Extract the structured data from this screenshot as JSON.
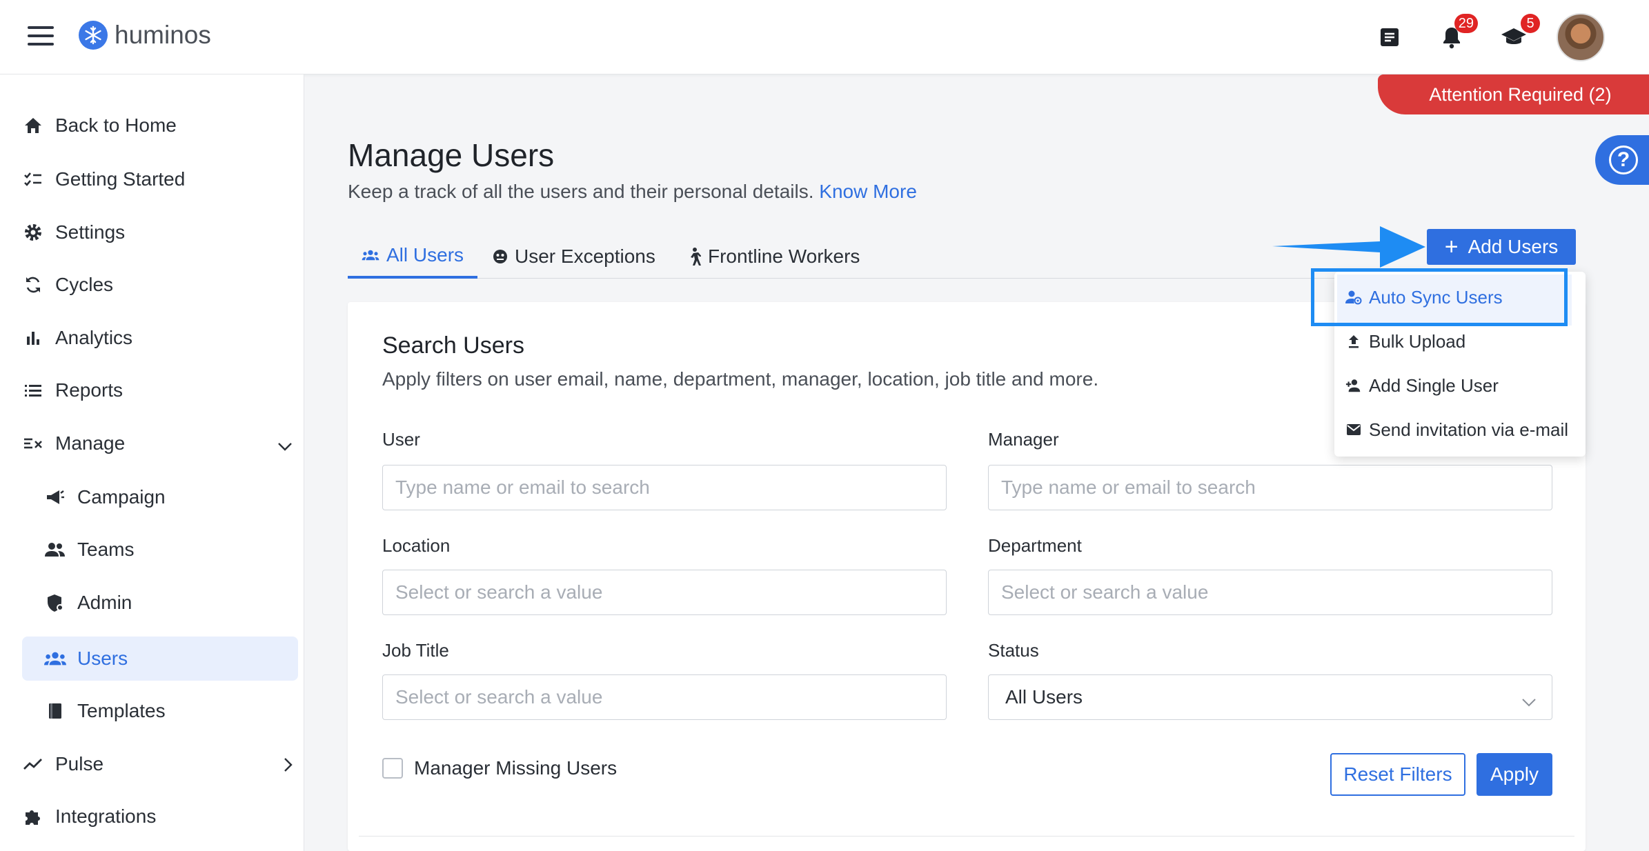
{
  "app": {
    "name": "huminos"
  },
  "header": {
    "notifications_count": "29",
    "courses_count": "5",
    "attention_label": "Attention Required (2)"
  },
  "sidebar": {
    "items": [
      {
        "label": "Back to Home",
        "icon": "home-icon"
      },
      {
        "label": "Getting Started",
        "icon": "checklist-icon"
      },
      {
        "label": "Settings",
        "icon": "gear-icon"
      },
      {
        "label": "Cycles",
        "icon": "cycle-icon"
      },
      {
        "label": "Analytics",
        "icon": "bar-chart-icon"
      },
      {
        "label": "Reports",
        "icon": "list-icon"
      },
      {
        "label": "Manage",
        "icon": "manage-icon"
      },
      {
        "label": "Campaign",
        "icon": "megaphone-icon"
      },
      {
        "label": "Teams",
        "icon": "people-icon"
      },
      {
        "label": "Admin",
        "icon": "shield-icon"
      },
      {
        "label": "Users",
        "icon": "group-icon"
      },
      {
        "label": "Templates",
        "icon": "book-icon"
      },
      {
        "label": "Pulse",
        "icon": "trend-icon"
      },
      {
        "label": "Integrations",
        "icon": "puzzle-icon"
      }
    ],
    "active": "Users"
  },
  "main": {
    "title": "Manage Users",
    "subtitle": "Keep a track of all the users and their personal details.",
    "know_more": "Know More",
    "tabs": [
      {
        "label": "All Users"
      },
      {
        "label": "User Exceptions"
      },
      {
        "label": "Frontline Workers"
      }
    ],
    "add_users_label": "Add Users",
    "dropdown": [
      {
        "label": "Auto Sync Users"
      },
      {
        "label": "Bulk Upload"
      },
      {
        "label": "Add Single User"
      },
      {
        "label": "Send invitation via e-mail"
      }
    ]
  },
  "search": {
    "title": "Search Users",
    "subtitle": "Apply filters on user email, name, department, manager, location, job title and more.",
    "fields": {
      "user": {
        "label": "User",
        "placeholder": "Type name or email to search"
      },
      "manager": {
        "label": "Manager",
        "placeholder": "Type name or email to search"
      },
      "location": {
        "label": "Location",
        "placeholder": "Select or search a value"
      },
      "department": {
        "label": "Department",
        "placeholder": "Select or search a value"
      },
      "job_title": {
        "label": "Job Title",
        "placeholder": "Select or search a value"
      },
      "status": {
        "label": "Status",
        "value": "All Users"
      }
    },
    "manager_missing_label": "Manager Missing Users",
    "reset_label": "Reset Filters",
    "apply_label": "Apply"
  },
  "colors": {
    "accent": "#2f6fe0",
    "alert": "#d93a3a",
    "highlight": "#1e8cf3"
  }
}
